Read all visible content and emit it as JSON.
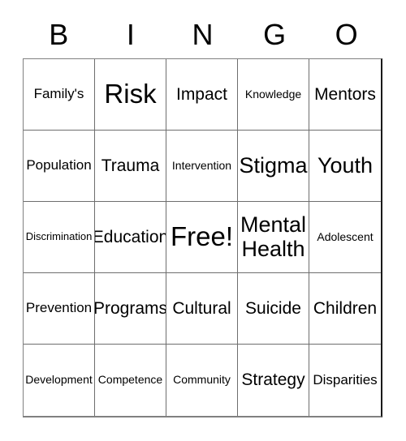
{
  "card": {
    "headers": [
      "B",
      "I",
      "N",
      "G",
      "O"
    ],
    "rows": [
      [
        {
          "text": "Family's",
          "size": "sm"
        },
        {
          "text": "Risk",
          "size": "xl"
        },
        {
          "text": "Impact",
          "size": "md"
        },
        {
          "text": "Knowledge",
          "size": "xs"
        },
        {
          "text": "Mentors",
          "size": "md"
        }
      ],
      [
        {
          "text": "Population",
          "size": "sm"
        },
        {
          "text": "Trauma",
          "size": "md"
        },
        {
          "text": "Intervention",
          "size": "xs"
        },
        {
          "text": "Stigma",
          "size": "lg"
        },
        {
          "text": "Youth",
          "size": "lg"
        }
      ],
      [
        {
          "text": "Discrimination",
          "size": "xxs"
        },
        {
          "text": "Education",
          "size": "md"
        },
        {
          "text": "Free!",
          "size": "xl"
        },
        {
          "text": "Mental\nHealth",
          "size": "lg"
        },
        {
          "text": "Adolescent",
          "size": "xs"
        }
      ],
      [
        {
          "text": "Prevention",
          "size": "sm"
        },
        {
          "text": "Programs",
          "size": "md"
        },
        {
          "text": "Cultural",
          "size": "md"
        },
        {
          "text": "Suicide",
          "size": "md"
        },
        {
          "text": "Children",
          "size": "md"
        }
      ],
      [
        {
          "text": "Development",
          "size": "xs"
        },
        {
          "text": "Competence",
          "size": "xs"
        },
        {
          "text": "Community",
          "size": "xs"
        },
        {
          "text": "Strategy",
          "size": "md"
        },
        {
          "text": "Disparities",
          "size": "sm"
        }
      ]
    ],
    "free_space": {
      "row": 2,
      "col": 2,
      "label": "Free!"
    },
    "colors": {
      "background": "#ffffff",
      "text": "#000000",
      "grid_line": "#6e6e6e",
      "border": "#1a1a1a"
    }
  }
}
